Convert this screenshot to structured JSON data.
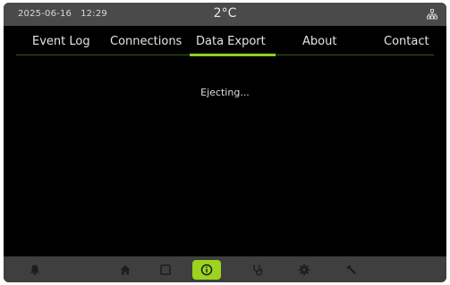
{
  "status_bar": {
    "date": "2025-06-16",
    "time": "12:29",
    "temperature": "2°C",
    "network_icon": "network-icon"
  },
  "tabs": [
    {
      "label": "Event Log",
      "active": false
    },
    {
      "label": "Connections",
      "active": false
    },
    {
      "label": "Data Export",
      "active": true
    },
    {
      "label": "About",
      "active": false
    },
    {
      "label": "Contact",
      "active": false
    }
  ],
  "content": {
    "message": "Ejecting..."
  },
  "bottom_nav": [
    {
      "icon": "bell-icon",
      "active": false
    },
    {
      "icon": "home-icon",
      "active": false
    },
    {
      "icon": "square-icon",
      "active": false
    },
    {
      "icon": "info-icon",
      "active": true
    },
    {
      "icon": "stethoscope-icon",
      "active": false
    },
    {
      "icon": "gear-icon",
      "active": false
    },
    {
      "icon": "wrench-icon",
      "active": false
    }
  ],
  "colors": {
    "accent": "#9bd31f",
    "status_bar": "#4a4a4a",
    "bottom_nav": "#3f3f3f",
    "background": "#000000"
  }
}
